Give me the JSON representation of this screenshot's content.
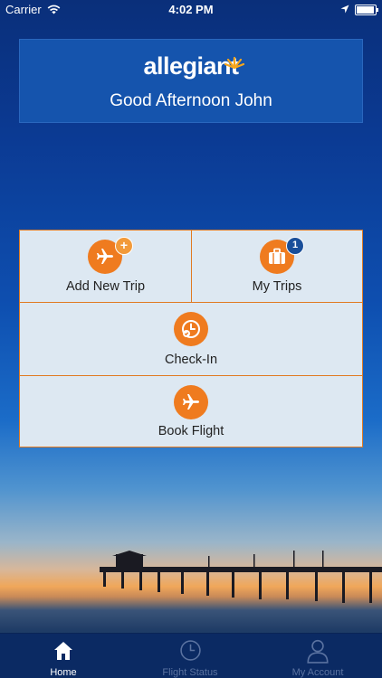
{
  "status_bar": {
    "carrier": "Carrier",
    "time": "4:02 PM"
  },
  "header": {
    "logo": "allegiant",
    "greeting": "Good Afternoon John"
  },
  "actions": {
    "add_new_trip": "Add New Trip",
    "my_trips": "My Trips",
    "my_trips_badge": "1",
    "add_badge": "+",
    "check_in": "Check-In",
    "book_flight": "Book Flight"
  },
  "tabs": [
    {
      "label": "Home",
      "icon": "home-icon",
      "active": true
    },
    {
      "label": "Flight Status",
      "icon": "clock-icon",
      "active": false
    },
    {
      "label": "My Account",
      "icon": "person-icon",
      "active": false
    }
  ],
  "colors": {
    "accent": "#ef7b1f",
    "brand_blue": "#1554ad",
    "tabbar": "#0b2a63",
    "cell_bg": "#dde8f2"
  }
}
